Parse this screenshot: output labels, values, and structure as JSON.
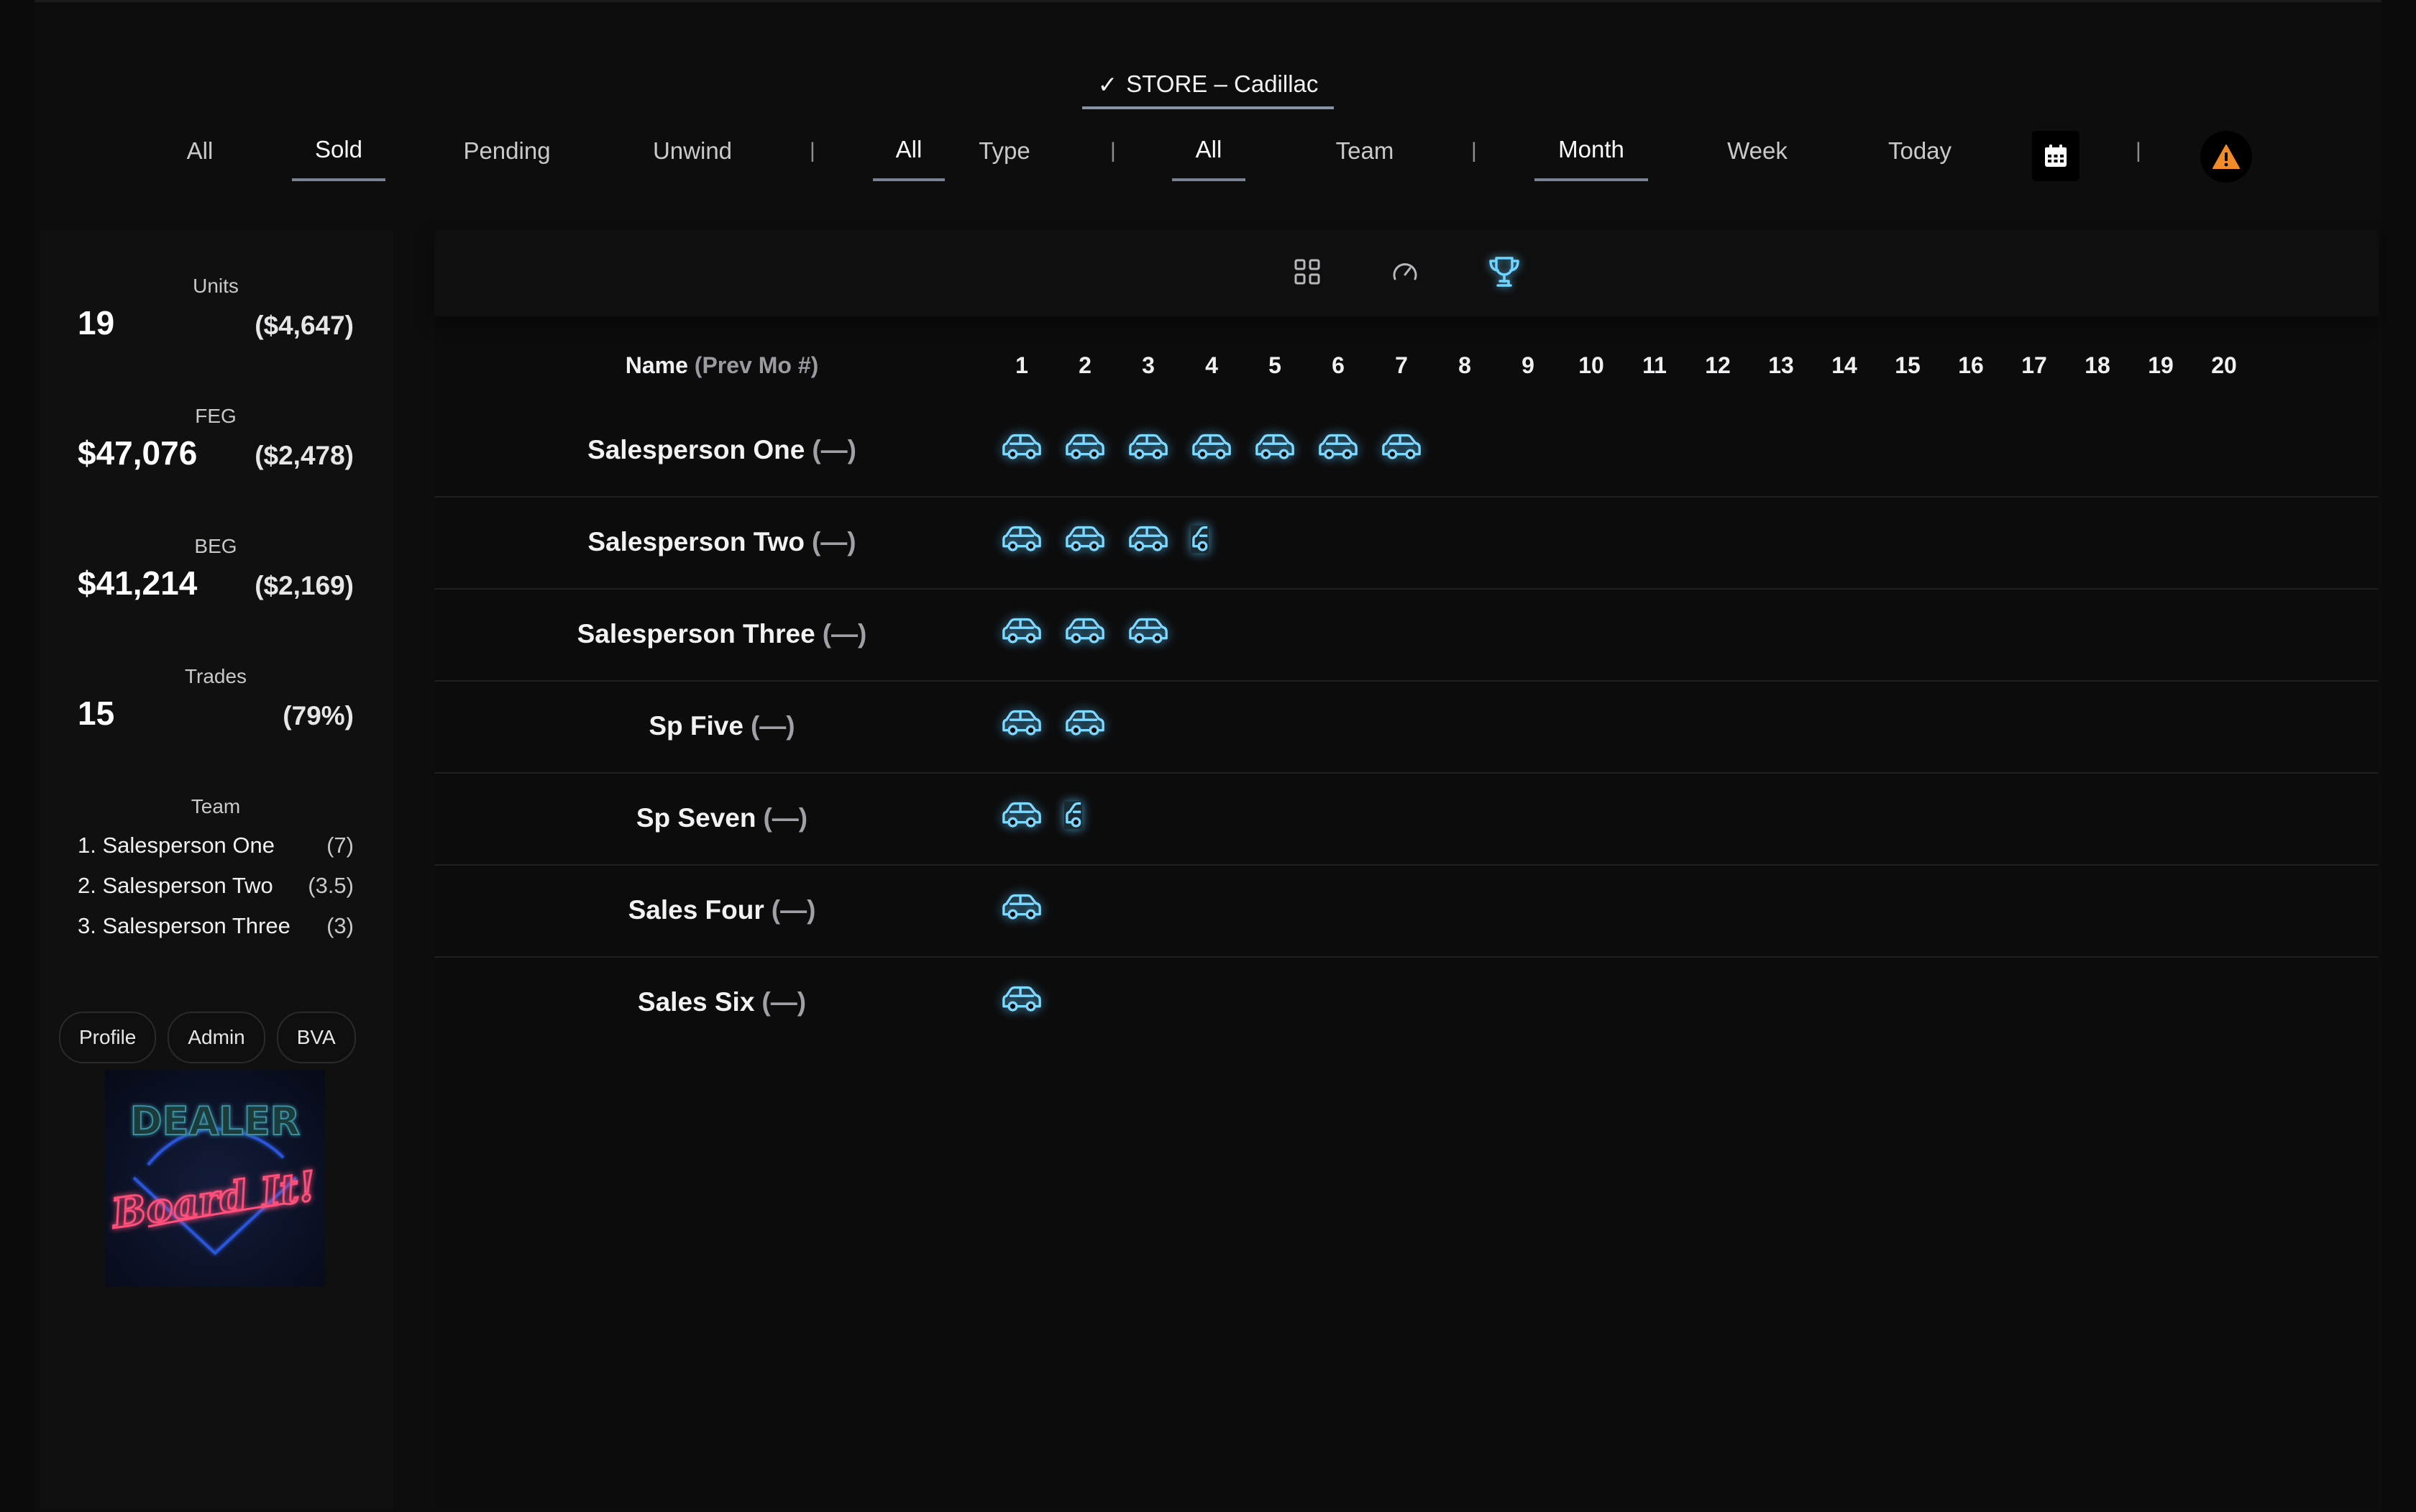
{
  "store": {
    "check": "✓",
    "label": "STORE – Cadillac"
  },
  "status_filters": [
    "All",
    "Sold",
    "Pending",
    "Unwind"
  ],
  "type_filters": [
    "All",
    "Type"
  ],
  "team_filters": [
    "All",
    "Team"
  ],
  "period_filters": [
    "Month",
    "Week",
    "Today"
  ],
  "separator": "|",
  "active": {
    "status": "Sold",
    "type": "All",
    "team": "All",
    "period": "Month"
  },
  "stats": {
    "units": {
      "label": "Units",
      "value": "19",
      "sub": "($4,647)"
    },
    "feg": {
      "label": "FEG",
      "value": "$47,076",
      "sub": "($2,478)"
    },
    "beg": {
      "label": "BEG",
      "value": "$41,214",
      "sub": "($2,169)"
    },
    "trades": {
      "label": "Trades",
      "value": "15",
      "sub": "(79%)"
    }
  },
  "team": {
    "title": "Team",
    "members": [
      {
        "name": "1. Salesperson One",
        "count": "(7)"
      },
      {
        "name": "2. Salesperson Two",
        "count": "(3.5)"
      },
      {
        "name": "3. Salesperson Three",
        "count": "(3)"
      }
    ]
  },
  "side_buttons": [
    "Profile",
    "Admin",
    "BVA"
  ],
  "logo": {
    "top": "DEALER",
    "script": "Board It!"
  },
  "view_icons": [
    "grid-icon",
    "gauge-icon",
    "trophy-icon"
  ],
  "board": {
    "name_header": "Name",
    "prev_header": "(Prev Mo #)",
    "columns": [
      "1",
      "2",
      "3",
      "4",
      "5",
      "6",
      "7",
      "8",
      "9",
      "10",
      "11",
      "12",
      "13",
      "14",
      "15",
      "16",
      "17",
      "18",
      "19",
      "20"
    ],
    "rows": [
      {
        "name": "Salesperson One",
        "prev": "(—)",
        "units": 7
      },
      {
        "name": "Salesperson Two",
        "prev": "(—)",
        "units": 3.5
      },
      {
        "name": "Salesperson Three",
        "prev": "(—)",
        "units": 3
      },
      {
        "name": "Sp Five",
        "prev": "(—)",
        "units": 2
      },
      {
        "name": "Sp Seven",
        "prev": "(—)",
        "units": 1.5
      },
      {
        "name": "Sales Four",
        "prev": "(—)",
        "units": 1
      },
      {
        "name": "Sales Six",
        "prev": "(—)",
        "units": 1
      }
    ]
  },
  "colors": {
    "accent": "#7fd8ff",
    "warning": "#f28c28",
    "background": "#0b0b0c"
  }
}
